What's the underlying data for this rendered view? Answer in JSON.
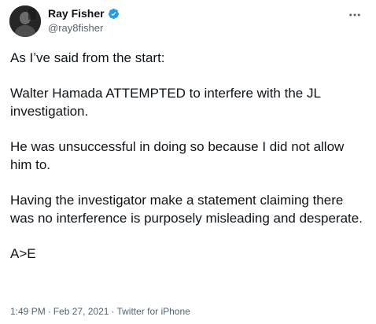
{
  "author": {
    "name": "Ray Fisher",
    "handle": "@ray8fisher",
    "verified": true,
    "avatar_icon": "profile-photo"
  },
  "tweet": {
    "paragraphs": [
      "As I’ve said from the start:",
      "Walter Hamada ATTEMPTED to interfere with the JL investigation.",
      "He was unsuccessful in doing so because I did not allow him to.",
      "Having the investigator make a statement claiming there was no interference is purposely misleading and desperate.",
      "A>E"
    ]
  },
  "meta": {
    "time": "1:49 PM",
    "separator": "·",
    "date": "Feb 27, 2021",
    "source": "Twitter for iPhone"
  },
  "colors": {
    "verified": "#1d9bf0",
    "secondary_text": "#536471",
    "primary_text": "#0f1419"
  },
  "icons": {
    "more": "more-options-icon",
    "verified": "verified-badge-icon"
  }
}
